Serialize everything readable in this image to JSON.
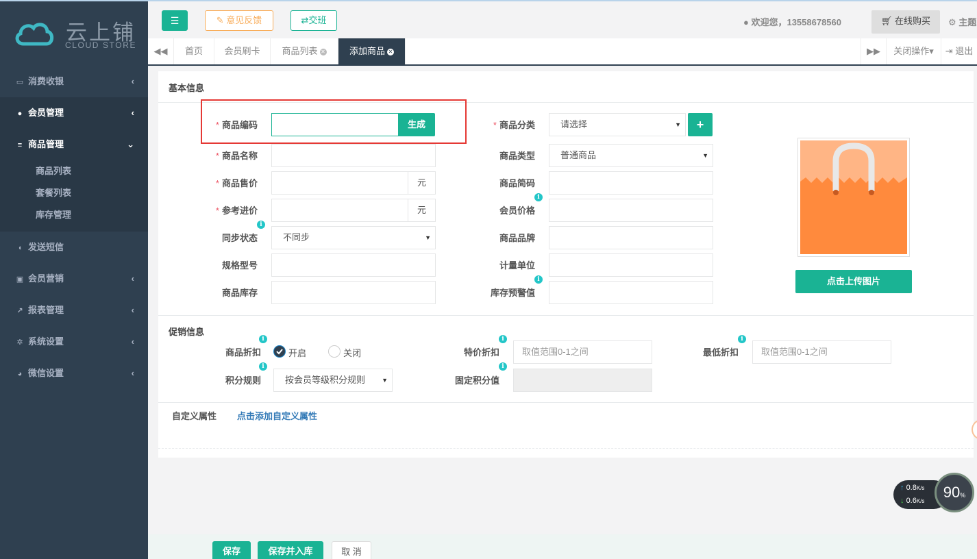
{
  "brand": {
    "name_cn": "云上铺",
    "name_en": "CLOUD STORE",
    "accent": "#1ab394",
    "sidebar_bg": "#2f4050"
  },
  "sidebar": {
    "items": [
      {
        "label": "消费收银",
        "icon": "card-icon"
      },
      {
        "label": "会员管理",
        "icon": "user-icon"
      },
      {
        "label": "商品管理",
        "icon": "database-icon",
        "children": [
          "商品列表",
          "套餐列表",
          "库存管理"
        ]
      },
      {
        "label": "发送短信",
        "icon": "comment-icon"
      },
      {
        "label": "会员营销",
        "icon": "briefcase-icon"
      },
      {
        "label": "报表管理",
        "icon": "chart-line-icon"
      },
      {
        "label": "系统设置",
        "icon": "cogs-icon"
      },
      {
        "label": "微信设置",
        "icon": "wechat-icon"
      }
    ]
  },
  "header": {
    "feedback": "意见反馈",
    "shift": "交班",
    "welcome": "欢迎您，13558678560",
    "buy": "在线购买",
    "theme": "主题"
  },
  "tabs": {
    "items": [
      "首页",
      "会员刷卡",
      "商品列表",
      "添加商品"
    ],
    "close_ops": "关闭操作",
    "logout": "退出"
  },
  "basic": {
    "title": "基本信息",
    "code_label": "商品编码",
    "code_value": "",
    "generate": "生成",
    "category_label": "商品分类",
    "category_value": "请选择",
    "name_label": "商品名称",
    "name_value": "",
    "type_label": "商品类型",
    "type_value": "普通商品",
    "price_label": "商品售价",
    "price_unit": "元",
    "abbr_label": "商品简码",
    "cost_label": "参考进价",
    "cost_unit": "元",
    "member_price_label": "会员价格",
    "sync_label": "同步状态",
    "sync_value": "不同步",
    "brand_label": "商品品牌",
    "spec_label": "规格型号",
    "unit_label": "计量单位",
    "stock_label": "商品库存",
    "warn_label": "库存预警值",
    "upload": "点击上传图片"
  },
  "promo": {
    "title": "促销信息",
    "discount_label": "商品折扣",
    "on": "开启",
    "off": "关闭",
    "discount_state": "on",
    "special_label": "特价折扣",
    "special_ph": "取值范围0-1之间",
    "min_label": "最低折扣",
    "min_ph": "取值范围0-1之间",
    "points_label": "积分规则",
    "points_value": "按会员等级积分规则",
    "fixed_points_label": "固定积分值"
  },
  "custom": {
    "label": "自定义属性",
    "link": "点击添加自定义属性"
  },
  "footer": {
    "save": "保存",
    "save_stock": "保存并入库",
    "cancel": "取 消"
  },
  "netmon": {
    "up": "0.8",
    "down": "0.6",
    "unit": "K/s",
    "percent": "90",
    "pct_sign": "%"
  }
}
